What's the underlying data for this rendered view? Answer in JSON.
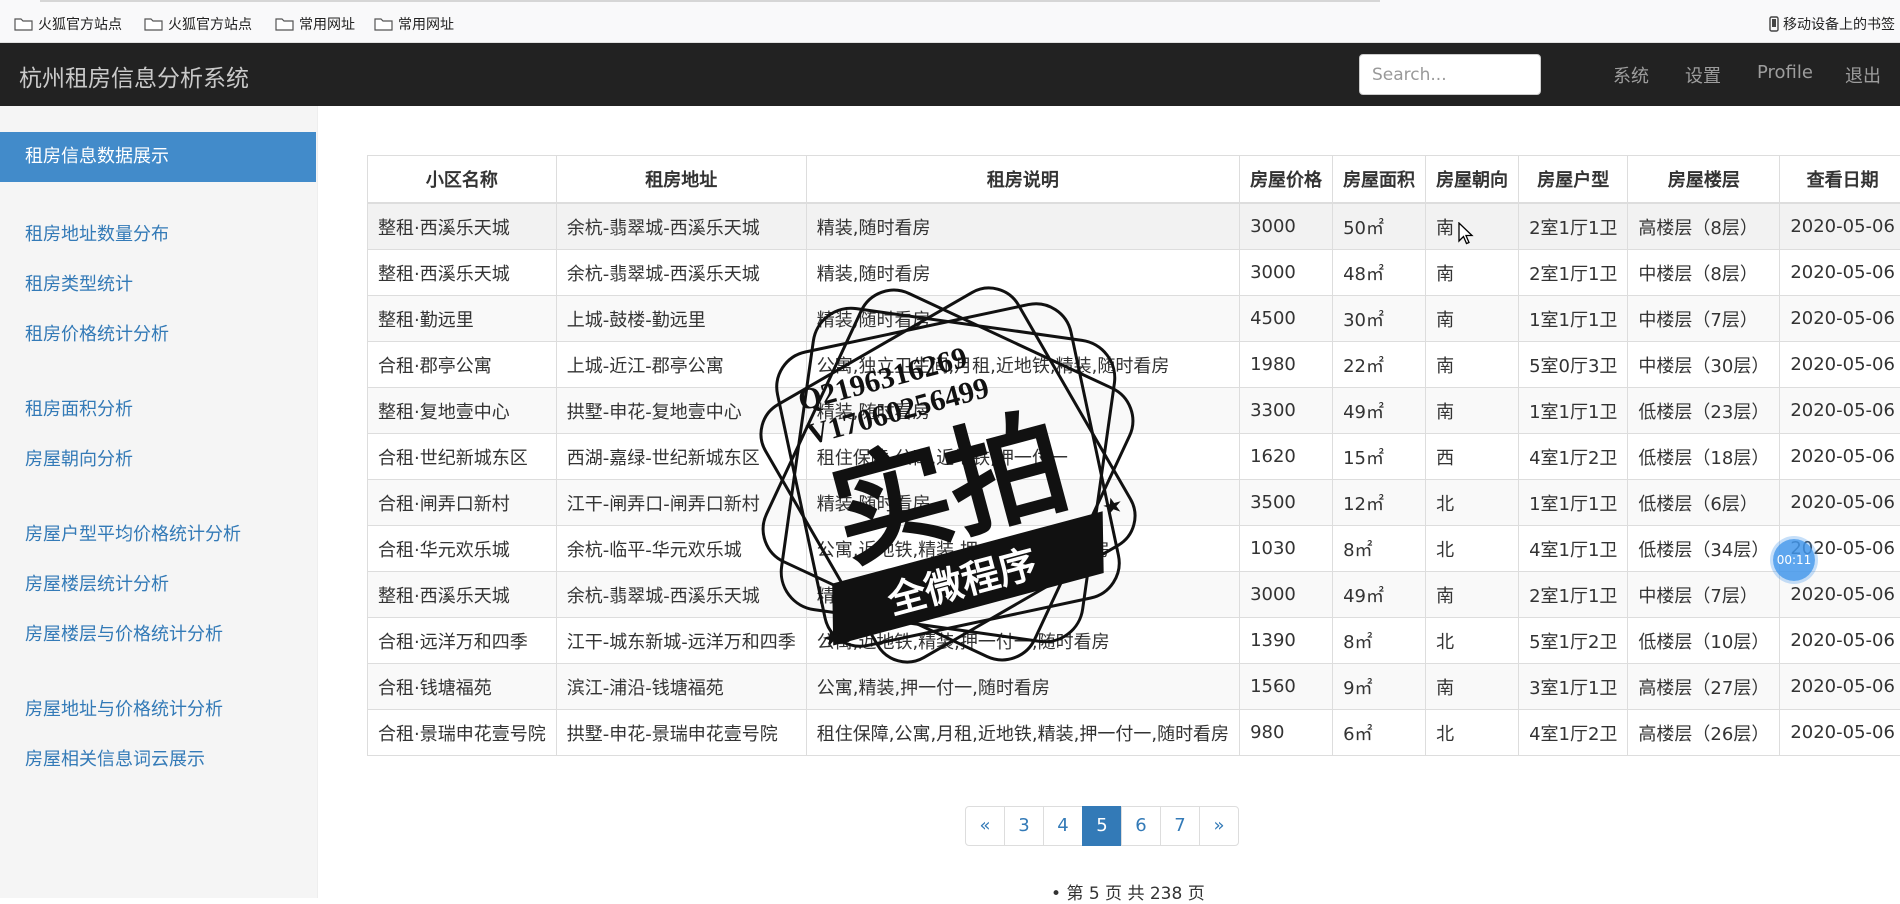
{
  "bookmarks": {
    "items": [
      {
        "label": "火狐官方站点"
      },
      {
        "label": "火狐官方站点"
      },
      {
        "label": "常用网址"
      },
      {
        "label": "常用网址"
      }
    ],
    "mobile_label": "移动设备上的书签"
  },
  "navbar": {
    "brand": "杭州租房信息分析系统",
    "search_placeholder": "Search...",
    "links": [
      "系统",
      "设置",
      "Profile",
      "退出"
    ]
  },
  "sidebar": {
    "active": "租房信息数据展示",
    "items": [
      "租房地址数量分布",
      "租房类型统计",
      "租房价格统计分析",
      "租房面积分析",
      "房屋朝向分析",
      "房屋户型平均价格统计分析",
      "房屋楼层统计分析",
      "房屋楼层与价格统计分析",
      "房屋地址与价格统计分析",
      "房屋相关信息词云展示"
    ]
  },
  "table": {
    "headers": [
      "小区名称",
      "租房地址",
      "租房说明",
      "房屋价格",
      "房屋面积",
      "房屋朝向",
      "房屋户型",
      "房屋楼层",
      "查看日期"
    ],
    "rows": [
      [
        "整租·西溪乐天城",
        "余杭-翡翠城-西溪乐天城",
        "精装,随时看房",
        "3000",
        "50㎡",
        "南",
        "2室1厅1卫",
        "高楼层（8层）",
        "2020-05-06"
      ],
      [
        "整租·西溪乐天城",
        "余杭-翡翠城-西溪乐天城",
        "精装,随时看房",
        "3000",
        "48㎡",
        "南",
        "2室1厅1卫",
        "中楼层（8层）",
        "2020-05-06"
      ],
      [
        "整租·勤远里",
        "上城-鼓楼-勤远里",
        "精装,随时看房",
        "4500",
        "30㎡",
        "南",
        "1室1厅1卫",
        "中楼层（7层）",
        "2020-05-06"
      ],
      [
        "合租·郡亭公寓",
        "上城-近江-郡亭公寓",
        "公寓,独立卫生间,月租,近地铁,精装,随时看房",
        "1980",
        "22㎡",
        "南",
        "5室0厅3卫",
        "中楼层（30层）",
        "2020-05-06"
      ],
      [
        "整租·复地壹中心",
        "拱墅-申花-复地壹中心",
        "精装,随时看房",
        "3300",
        "49㎡",
        "南",
        "1室1厅1卫",
        "低楼层（23层）",
        "2020-05-06"
      ],
      [
        "合租·世纪新城东区",
        "西湖-嘉绿-世纪新城东区",
        "租住保障,公寓,近地铁,押一付一",
        "1620",
        "15㎡",
        "西",
        "4室1厅2卫",
        "低楼层（18层）",
        "2020-05-06"
      ],
      [
        "合租·闸弄口新村",
        "江干-闸弄口-闸弄口新村",
        "精装,随时看房",
        "3500",
        "12㎡",
        "北",
        "1室1厅1卫",
        "低楼层（6层）",
        "2020-05-06"
      ],
      [
        "合租·华元欢乐城",
        "余杭-临平-华元欢乐城",
        "公寓,近地铁,精装,押一付一,随时看房",
        "1030",
        "8㎡",
        "北",
        "4室1厅1卫",
        "低楼层（34层）",
        "2020-05-06"
      ],
      [
        "整租·西溪乐天城",
        "余杭-翡翠城-西溪乐天城",
        "精装,随时看房",
        "3000",
        "49㎡",
        "南",
        "2室1厅1卫",
        "中楼层（7层）",
        "2020-05-06"
      ],
      [
        "合租·远洋万和四季",
        "江干-城东新城-远洋万和四季",
        "公寓,近地铁,精装,押一付一,随时看房",
        "1390",
        "8㎡",
        "北",
        "5室1厅2卫",
        "低楼层（10层）",
        "2020-05-06"
      ],
      [
        "合租·钱塘福苑",
        "滨江-浦沿-钱塘福苑",
        "公寓,精装,押一付一,随时看房",
        "1560",
        "9㎡",
        "南",
        "3室1厅1卫",
        "高楼层（27层）",
        "2020-05-06"
      ],
      [
        "合租·景瑞申花壹号院",
        "拱墅-申花-景瑞申花壹号院",
        "租住保障,公寓,月租,近地铁,精装,押一付一,随时看房",
        "980",
        "6㎡",
        "北",
        "4室1厅2卫",
        "高楼层（26层）",
        "2020-05-06"
      ]
    ]
  },
  "pagination": {
    "prev": "«",
    "pages": [
      "3",
      "4",
      "5",
      "6",
      "7"
    ],
    "active": "5",
    "next": "»",
    "info": "第 5 页 共 238 页"
  },
  "overlay": {
    "timer": "00:11",
    "stamp_line1": "Q2196316269",
    "stamp_line2": "V17060256499",
    "stamp_main": "实拍",
    "stamp_banner": "全微程序"
  }
}
